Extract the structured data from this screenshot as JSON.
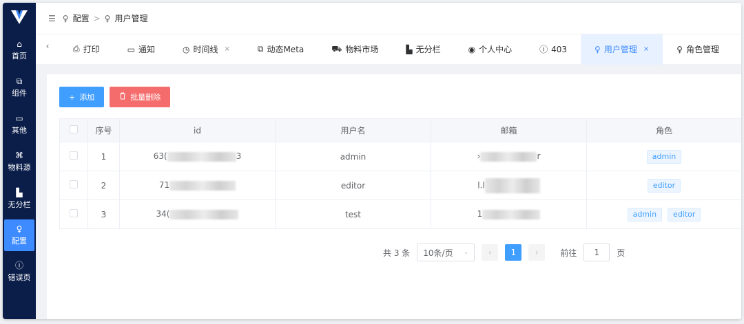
{
  "sidebar": {
    "items": [
      {
        "icon": "home-icon",
        "glyph": "⌂",
        "label": "首页"
      },
      {
        "icon": "code-icon",
        "glyph": "⧉",
        "label": "组件"
      },
      {
        "icon": "box-icon",
        "glyph": "▭",
        "label": "其他"
      },
      {
        "icon": "command-icon",
        "glyph": "⌘",
        "label": "物料源"
      },
      {
        "icon": "layout-icon",
        "glyph": "▙",
        "label": "无分栏"
      },
      {
        "icon": "user-settings-icon",
        "glyph": "♀",
        "label": "配置"
      },
      {
        "icon": "alert-circle-icon",
        "glyph": "ⓘ",
        "label": "错误页"
      }
    ]
  },
  "header": {
    "collapse_glyph": "☰",
    "crumbs": [
      {
        "glyph": "♀",
        "label": "配置"
      },
      {
        "glyph": "♀",
        "label": "用户管理"
      }
    ],
    "sep": ">"
  },
  "tabs": {
    "prev": "‹",
    "items": [
      {
        "glyph": "⎙",
        "label": "打印",
        "close": ""
      },
      {
        "glyph": "▭",
        "label": "通知",
        "close": ""
      },
      {
        "glyph": "◷",
        "label": "时间线",
        "close": "×"
      },
      {
        "glyph": "⧉",
        "label": "动态Meta",
        "close": ""
      },
      {
        "glyph": "⛟",
        "label": "物料市场",
        "close": ""
      },
      {
        "glyph": "▙",
        "label": "无分栏",
        "close": ""
      },
      {
        "glyph": "◉",
        "label": "个人中心",
        "close": ""
      },
      {
        "glyph": "ⓘ",
        "label": "403",
        "close": ""
      },
      {
        "glyph": "♀",
        "label": "用户管理",
        "close": "×"
      },
      {
        "glyph": "♀",
        "label": "角色管理",
        "close": ""
      }
    ]
  },
  "toolbar": {
    "add_label": "添加",
    "add_glyph": "+",
    "delete_label": "批量删除",
    "delete_glyph": "🗑"
  },
  "table": {
    "headers": [
      "",
      "序号",
      "id",
      "用户名",
      "邮箱",
      "角色"
    ],
    "rows": [
      {
        "index": "1",
        "id": "63(",
        "id_tail": "3",
        "username": "admin",
        "email": "›",
        "email_tail": "r",
        "roles": [
          "admin"
        ]
      },
      {
        "index": "2",
        "id": "71",
        "id_tail": "",
        "username": "editor",
        "email": "l.l",
        "email_tail": "",
        "roles": [
          "editor"
        ]
      },
      {
        "index": "3",
        "id": "34(",
        "id_tail": "",
        "username": "test",
        "email": "1",
        "email_tail": "",
        "roles": [
          "admin",
          "editor"
        ]
      }
    ]
  },
  "pagination": {
    "total": "共 3 条",
    "page_size": "10条/页",
    "current": "1",
    "goto_label": "前往",
    "goto_value": "1",
    "page_suffix": "页"
  },
  "colors": {
    "sidebar_bg": "#0b1e4a",
    "primary": "#409eff",
    "danger": "#f56c6c"
  }
}
